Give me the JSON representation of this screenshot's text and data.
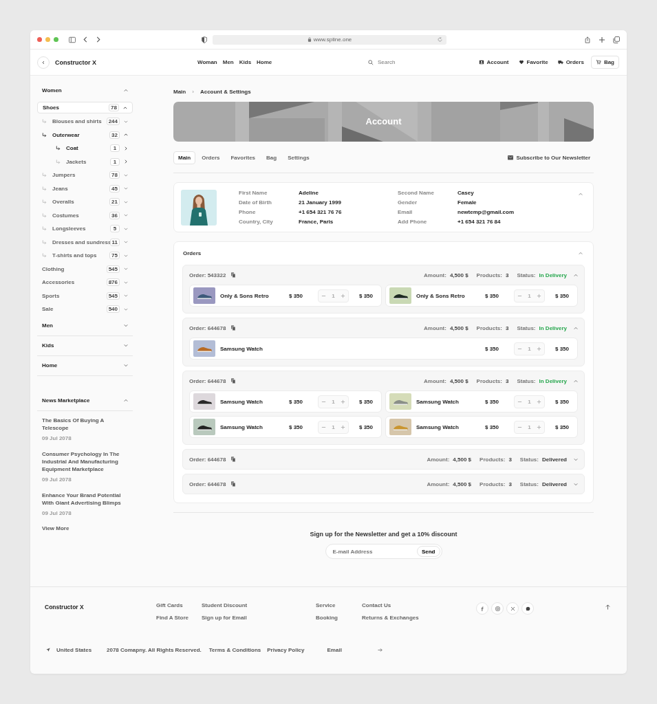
{
  "browser": {
    "url": "www.spline.one"
  },
  "header": {
    "brand": "Constructor X",
    "nav": [
      "Woman",
      "Men",
      "Kids",
      "Home"
    ],
    "search": {
      "placeholder": "Search"
    },
    "actions": [
      {
        "label": "Account",
        "kind": "link"
      },
      {
        "label": "Favorite",
        "kind": "link"
      },
      {
        "label": "Orders",
        "kind": "link"
      },
      {
        "label": "Bag",
        "kind": "button"
      }
    ]
  },
  "sidebar": {
    "sections": [
      {
        "title": "Women",
        "expanded": true,
        "items": [
          {
            "label": "Shoes",
            "count": "78",
            "kind": "group",
            "expanded": true,
            "selected": true,
            "children": [
              {
                "label": "Blouses and shirts",
                "count": "244",
                "kind": "group",
                "expanded": false,
                "selected": false
              },
              {
                "label": "Outerwear",
                "count": "32",
                "kind": "group",
                "expanded": true,
                "selected": true,
                "children": [
                  {
                    "label": "Coat",
                    "count": "1",
                    "kind": "leaf",
                    "selected": true
                  },
                  {
                    "label": "Jackets",
                    "count": "1",
                    "kind": "leaf",
                    "selected": false
                  }
                ]
              },
              {
                "label": "Jumpers",
                "count": "78",
                "kind": "group",
                "expanded": false,
                "selected": false
              },
              {
                "label": "Jeans",
                "count": "45",
                "kind": "group",
                "expanded": false,
                "selected": false
              },
              {
                "label": "Overalls",
                "count": "21",
                "kind": "group",
                "expanded": false,
                "selected": false
              },
              {
                "label": "Costumes",
                "count": "36",
                "kind": "group",
                "expanded": false,
                "selected": false
              },
              {
                "label": "Longsleeves",
                "count": "5",
                "kind": "group",
                "expanded": false,
                "selected": false
              },
              {
                "label": "Dresses and sundress",
                "count": "11",
                "kind": "group",
                "expanded": false,
                "selected": false
              },
              {
                "label": "T-shirts and tops",
                "count": "75",
                "kind": "group",
                "expanded": false,
                "selected": false
              }
            ]
          },
          {
            "label": "Clothing",
            "count": "545",
            "kind": "group",
            "expanded": false,
            "selected": false
          },
          {
            "label": "Accessories",
            "count": "876",
            "kind": "group",
            "expanded": false,
            "selected": false
          },
          {
            "label": "Sports",
            "count": "545",
            "kind": "group",
            "expanded": false,
            "selected": false
          },
          {
            "label": "Sale",
            "count": "540",
            "kind": "group",
            "expanded": false,
            "selected": false
          }
        ]
      },
      {
        "title": "Men",
        "expanded": false
      },
      {
        "title": "Kids",
        "expanded": false
      },
      {
        "title": "Home",
        "expanded": false
      }
    ],
    "news": {
      "title": "News Marketplace",
      "expanded": true,
      "items": [
        {
          "title": "The Basics Of Buying A Telescope",
          "date": "09 Jul 2078"
        },
        {
          "title": "Consumer Psychology In The Industrial And Manufacturing Equipment Marketplace",
          "date": "09 Jul 2078"
        },
        {
          "title": "Enhance Your Brand Potential With Giant Advertising Blimps",
          "date": "09 Jul 2078"
        }
      ],
      "more": "View More"
    }
  },
  "breadcrumb": {
    "items": [
      "Main",
      "Account & Settings"
    ],
    "separator": "›"
  },
  "banner": {
    "title": "Account"
  },
  "tabs": [
    {
      "label": "Main",
      "selected": true
    },
    {
      "label": "Orders",
      "selected": false
    },
    {
      "label": "Favorites",
      "selected": false
    },
    {
      "label": "Bag",
      "selected": false
    },
    {
      "label": "Settings",
      "selected": false
    }
  ],
  "subscribe": "Subscribe to Our Newsletter",
  "profile": {
    "expanded": true,
    "left": [
      {
        "label": "First Name",
        "value": "Adeline"
      },
      {
        "label": "Date of Birth",
        "value": "21 January 1999"
      },
      {
        "label": "Phone",
        "value": "+1 654 321 76 76"
      },
      {
        "label": "Country, City",
        "value": "France, Paris"
      }
    ],
    "right": [
      {
        "label": "Second Name",
        "value": "Casey"
      },
      {
        "label": "Gender",
        "value": "Female"
      },
      {
        "label": "Email",
        "value": "newtemp@gmail.com"
      },
      {
        "label": "Add Phone",
        "value": "+1 654 321 76 84"
      }
    ]
  },
  "orders": {
    "title": "Orders",
    "expanded": true,
    "list": [
      {
        "order": "Order: 543322",
        "amount_label": "Amount:",
        "amount": "4,500 $",
        "products_label": "Products:",
        "products": "3",
        "status_label": "Status:",
        "status": "In Delivery",
        "color": "#22a54a",
        "expanded": true,
        "items": [
          {
            "name": "Only & Sons Retro",
            "price": "$ 350",
            "qty": "1",
            "total": "$ 350"
          },
          {
            "name": "Only & Sons Retro",
            "price": "$ 350",
            "qty": "1",
            "total": "$ 350"
          }
        ]
      },
      {
        "order": "Order: 644678",
        "amount_label": "Amount:",
        "amount": "4,500 $",
        "products_label": "Products:",
        "products": "3",
        "status_label": "Status:",
        "status": "In Delivery",
        "color": "#22a54a",
        "expanded": true,
        "items": [
          {
            "name": "Samsung Watch",
            "price": "$ 350",
            "qty": "1",
            "total": "$ 350"
          }
        ]
      },
      {
        "order": "Order: 644678",
        "amount_label": "Amount:",
        "amount": "4,500 $",
        "products_label": "Products:",
        "products": "3",
        "status_label": "Status:",
        "status": "In Delivery",
        "color": "#22a54a",
        "expanded": true,
        "items": [
          {
            "name": "Samsung Watch",
            "price": "$ 350",
            "qty": "1",
            "total": "$ 350"
          },
          {
            "name": "Samsung Watch",
            "price": "$ 350",
            "qty": "1",
            "total": "$ 350"
          },
          {
            "name": "Samsung Watch",
            "price": "$ 350",
            "qty": "1",
            "total": "$ 350"
          },
          {
            "name": "Samsung Watch",
            "price": "$ 350",
            "qty": "1",
            "total": "$ 350"
          }
        ]
      },
      {
        "order": "Order: 644678",
        "amount_label": "Amount:",
        "amount": "4,500 $",
        "products_label": "Products:",
        "products": "3",
        "status_label": "Status:",
        "status": "Delivered",
        "color": "#333333",
        "expanded": false
      },
      {
        "order": "Order: 644678",
        "amount_label": "Amount:",
        "amount": "4,500 $",
        "products_label": "Products:",
        "products": "3",
        "status_label": "Status:",
        "status": "Delivered",
        "color": "#333333",
        "expanded": false
      }
    ]
  },
  "newsletter": {
    "title": "Sign up for the Newsletter and get a 10% discount",
    "placeholder": "E-mail Address",
    "button": "Send"
  },
  "footer": {
    "brand": "Constructor X",
    "columns": [
      [
        "Gift Cards",
        "Find A Store"
      ],
      [
        "Student Discount",
        "Sign up for Email"
      ],
      [
        "Service",
        "Booking"
      ],
      [
        "Contact Us",
        "Returns & Exchanges"
      ]
    ],
    "country": "United States",
    "copyright": "2078 Comapny. All Rights Reserved.",
    "links": [
      "Terms & Conditions",
      "Privacy Policy"
    ],
    "email_label": "Email"
  }
}
